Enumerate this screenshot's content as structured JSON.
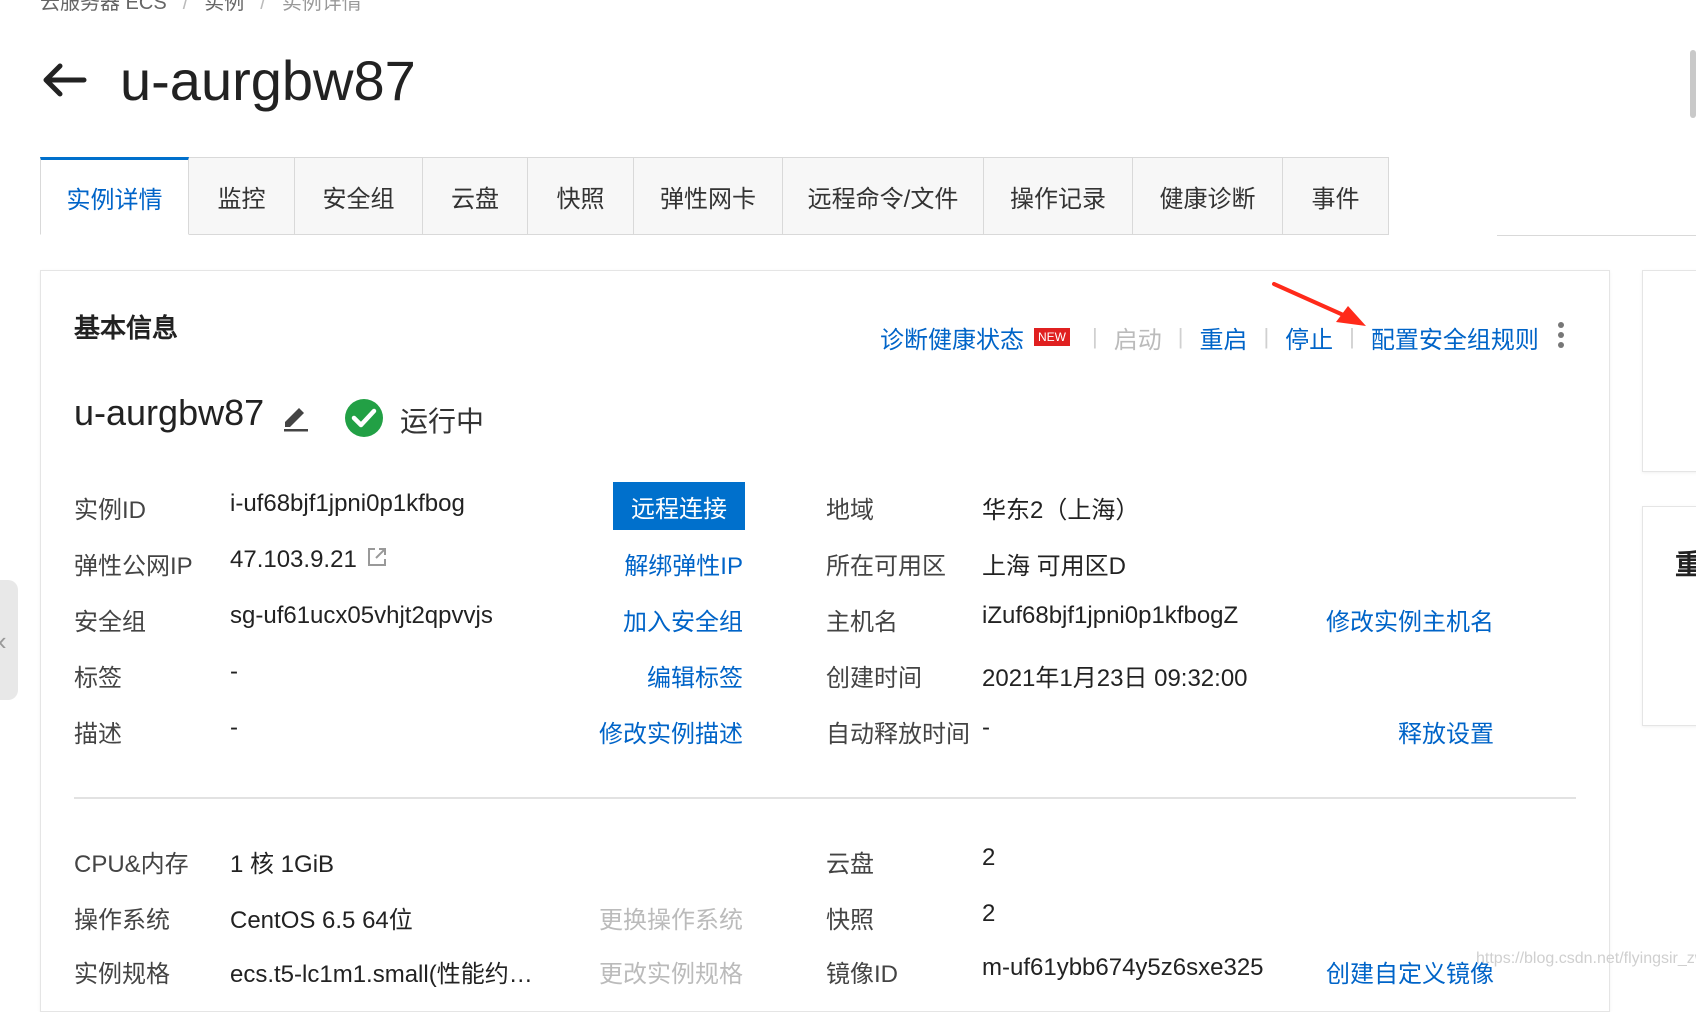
{
  "breadcrumb": {
    "item1": "云服务器 ECS",
    "sep": "/",
    "item2": "实例",
    "item3": "实例详情"
  },
  "page": {
    "title": "u-aurgbw87"
  },
  "tabs": [
    "实例详情",
    "监控",
    "安全组",
    "云盘",
    "快照",
    "弹性网卡",
    "远程命令/文件",
    "操作记录",
    "健康诊断",
    "事件"
  ],
  "basic": {
    "title": "基本信息",
    "actions": {
      "diagnose": "诊断健康状态",
      "new_badge": "NEW",
      "start": "启动",
      "restart": "重启",
      "stop": "停止",
      "config_sg": "配置安全组规则"
    },
    "name": "u-aurgbw87",
    "status": "运行中",
    "left_rows": [
      {
        "label": "实例ID",
        "value": "i-uf68bjf1jpni0p1kfbog",
        "action": "远程连接"
      },
      {
        "label": "弹性公网IP",
        "value": "47.103.9.21",
        "action": "解绑弹性IP"
      },
      {
        "label": "安全组",
        "value": "sg-uf61ucx05vhjt2qpvvjs",
        "action": "加入安全组"
      },
      {
        "label": "标签",
        "value": "-",
        "action": "编辑标签"
      },
      {
        "label": "描述",
        "value": "-",
        "action": "修改实例描述"
      }
    ],
    "right_rows": [
      {
        "label": "地域",
        "value": "华东2（上海）",
        "action": ""
      },
      {
        "label": "所在可用区",
        "value": "上海 可用区D",
        "action": ""
      },
      {
        "label": "主机名",
        "value": "iZuf68bjf1jpni0p1kfbogZ",
        "action": "修改实例主机名"
      },
      {
        "label": "创建时间",
        "value": "2021年1月23日 09:32:00",
        "action": ""
      },
      {
        "label": "自动释放时间",
        "value": "-",
        "action": "释放设置"
      }
    ],
    "config_left": [
      {
        "label": "CPU&内存",
        "value": "1 核 1GiB",
        "action": ""
      },
      {
        "label": "操作系统",
        "value": "CentOS 6.5 64位",
        "action": "更换操作系统"
      },
      {
        "label": "实例规格",
        "value": "ecs.t5-lc1m1.small(性能约…",
        "action": "更改实例规格"
      }
    ],
    "config_right": [
      {
        "label": "云盘",
        "value": "2",
        "action": ""
      },
      {
        "label": "快照",
        "value": "2",
        "action": ""
      },
      {
        "label": "镜像ID",
        "value": "m-uf61ybb674y5z6sxe325",
        "action": "创建自定义镜像"
      }
    ]
  },
  "side_panel": {
    "char": "重"
  },
  "watermark": "https://blog.csdn.net/flyingsir_zw",
  "colors": {
    "link": "#0064c8",
    "primary": "#0070cc",
    "success": "#22a045",
    "badge": "#e02020",
    "annotation_arrow": "#ff2a1a"
  },
  "icons": {
    "back": "arrow-left-icon",
    "edit": "pencil-icon",
    "status": "check-circle-icon",
    "external": "external-link-icon",
    "more": "more-vertical-icon"
  }
}
